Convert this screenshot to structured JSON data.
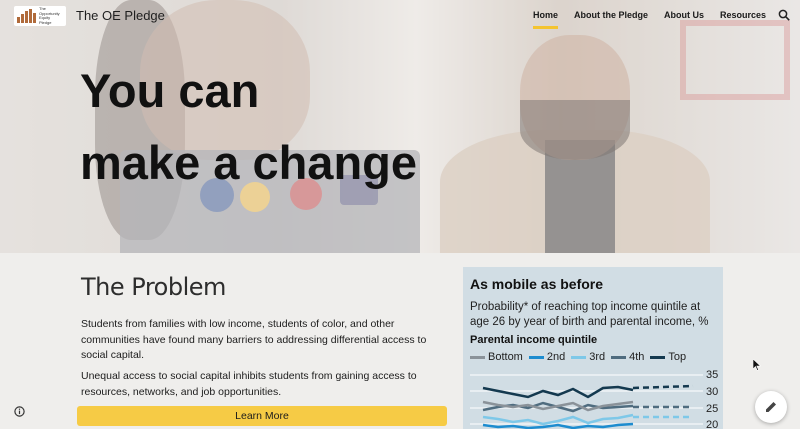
{
  "header": {
    "logo_text": "The Opportunity Equity Pledge",
    "site_title": "The OE Pledge",
    "nav": [
      {
        "label": "Home",
        "active": true
      },
      {
        "label": "About the Pledge",
        "active": false
      },
      {
        "label": "About Us",
        "active": false
      },
      {
        "label": "Resources",
        "active": false
      }
    ],
    "search_icon": "search-icon"
  },
  "hero": {
    "headline_line1": "You can",
    "headline_line2": "make a change"
  },
  "problem": {
    "title": "The Problem",
    "paragraph1": "Students from families with low income, students of color, and other communities have found many barriers to addressing differential access to social capital.",
    "paragraph2": "Unequal access to social capital inhibits students from gaining access to resources, networks, and job opportunities.",
    "button_label": "Learn More"
  },
  "chart_data": {
    "type": "line",
    "title": "As mobile as before",
    "subtitle": "Probability* of reaching top income quintile at age 26 by year of birth and parental income, %",
    "legend_title": "Parental income quintile",
    "series": [
      {
        "name": "Bottom",
        "color": "#8a9299"
      },
      {
        "name": "2nd",
        "color": "#1d8ccf"
      },
      {
        "name": "3rd",
        "color": "#7ec8e8"
      },
      {
        "name": "4th",
        "color": "#4f6c7f"
      },
      {
        "name": "Top",
        "color": "#14394f"
      }
    ],
    "y_ticks": [
      "35",
      "30",
      "25",
      "20"
    ]
  },
  "colors": {
    "accent": "#f6cb45",
    "chart_bg": "#d1dde4"
  },
  "icons": {
    "info": "info-icon",
    "edit": "pencil-icon"
  }
}
